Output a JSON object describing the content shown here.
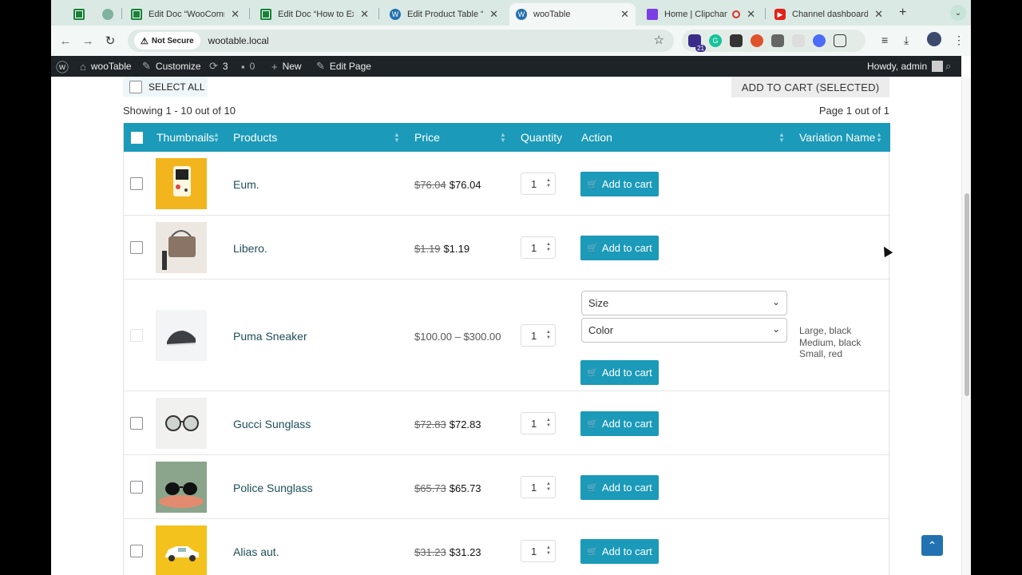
{
  "browser": {
    "tabs": [
      {
        "title": "",
        "icon": "sheets-icon"
      },
      {
        "title": "",
        "icon": "app-icon"
      },
      {
        "title": "Edit Doc “WooCommer",
        "icon": "sheets-icon"
      },
      {
        "title": "Edit Doc “How to Expo",
        "icon": "sheets-icon"
      },
      {
        "title": "Edit Product Table “Pro",
        "icon": "wordpress-icon"
      },
      {
        "title": "wooTable",
        "icon": "wordpress-icon"
      },
      {
        "title": "Home | Clipchamp",
        "icon": "clipchamp-icon"
      },
      {
        "title": "Channel dashboard - Y",
        "icon": "youtube-icon"
      }
    ],
    "close_glyph": "✕",
    "new_tab_glyph": "+",
    "not_secure_label": "Not Secure",
    "url": "wootable.local",
    "extension_badge": "21"
  },
  "adminbar": {
    "site_name": "wooTable",
    "customize": "Customize",
    "updates_count": "3",
    "comments_count": "0",
    "new_label": "New",
    "edit_page": "Edit Page",
    "howdy": "Howdy, admin"
  },
  "table_controls": {
    "select_all_label": "SELECT ALL",
    "add_selected_label": "ADD TO CART (SELECTED)",
    "showing_text": "Showing 1 - 10 out of 10",
    "page_text": "Page 1 out of 1"
  },
  "columns": [
    "Thumbnails",
    "Products",
    "Price",
    "Quantity",
    "Action",
    "Variation Name"
  ],
  "add_to_cart_label": "Add to cart",
  "rows": [
    {
      "name": "Eum.",
      "old_price": "$76.04",
      "price": "$76.04",
      "qty": "1",
      "thumb": "gameboy"
    },
    {
      "name": "Libero.",
      "old_price": "$1.19",
      "price": "$1.19",
      "qty": "1",
      "thumb": "handbag"
    },
    {
      "name": "Puma Sneaker",
      "price_range": "$100.00 – $300.00",
      "qty": "1",
      "thumb": "sneaker",
      "selects": {
        "size_placeholder": "Size",
        "color_placeholder": "Color"
      },
      "variations": [
        "Large, black",
        "Medium, black",
        "Small, red"
      ]
    },
    {
      "name": "Gucci Sunglass",
      "old_price": "$72.83",
      "price": "$72.83",
      "qty": "1",
      "thumb": "sunglass-white"
    },
    {
      "name": "Police Sunglass",
      "old_price": "$65.73",
      "price": "$65.73",
      "qty": "1",
      "thumb": "sunglass-dark"
    },
    {
      "name": "Alias aut.",
      "old_price": "$31.23",
      "price": "$31.23",
      "qty": "1",
      "thumb": "car"
    }
  ],
  "colors": {
    "header": "#1b9ab9",
    "button": "#1b9ab9",
    "adminbar": "#1d2327",
    "link": "#1d4e5a"
  }
}
